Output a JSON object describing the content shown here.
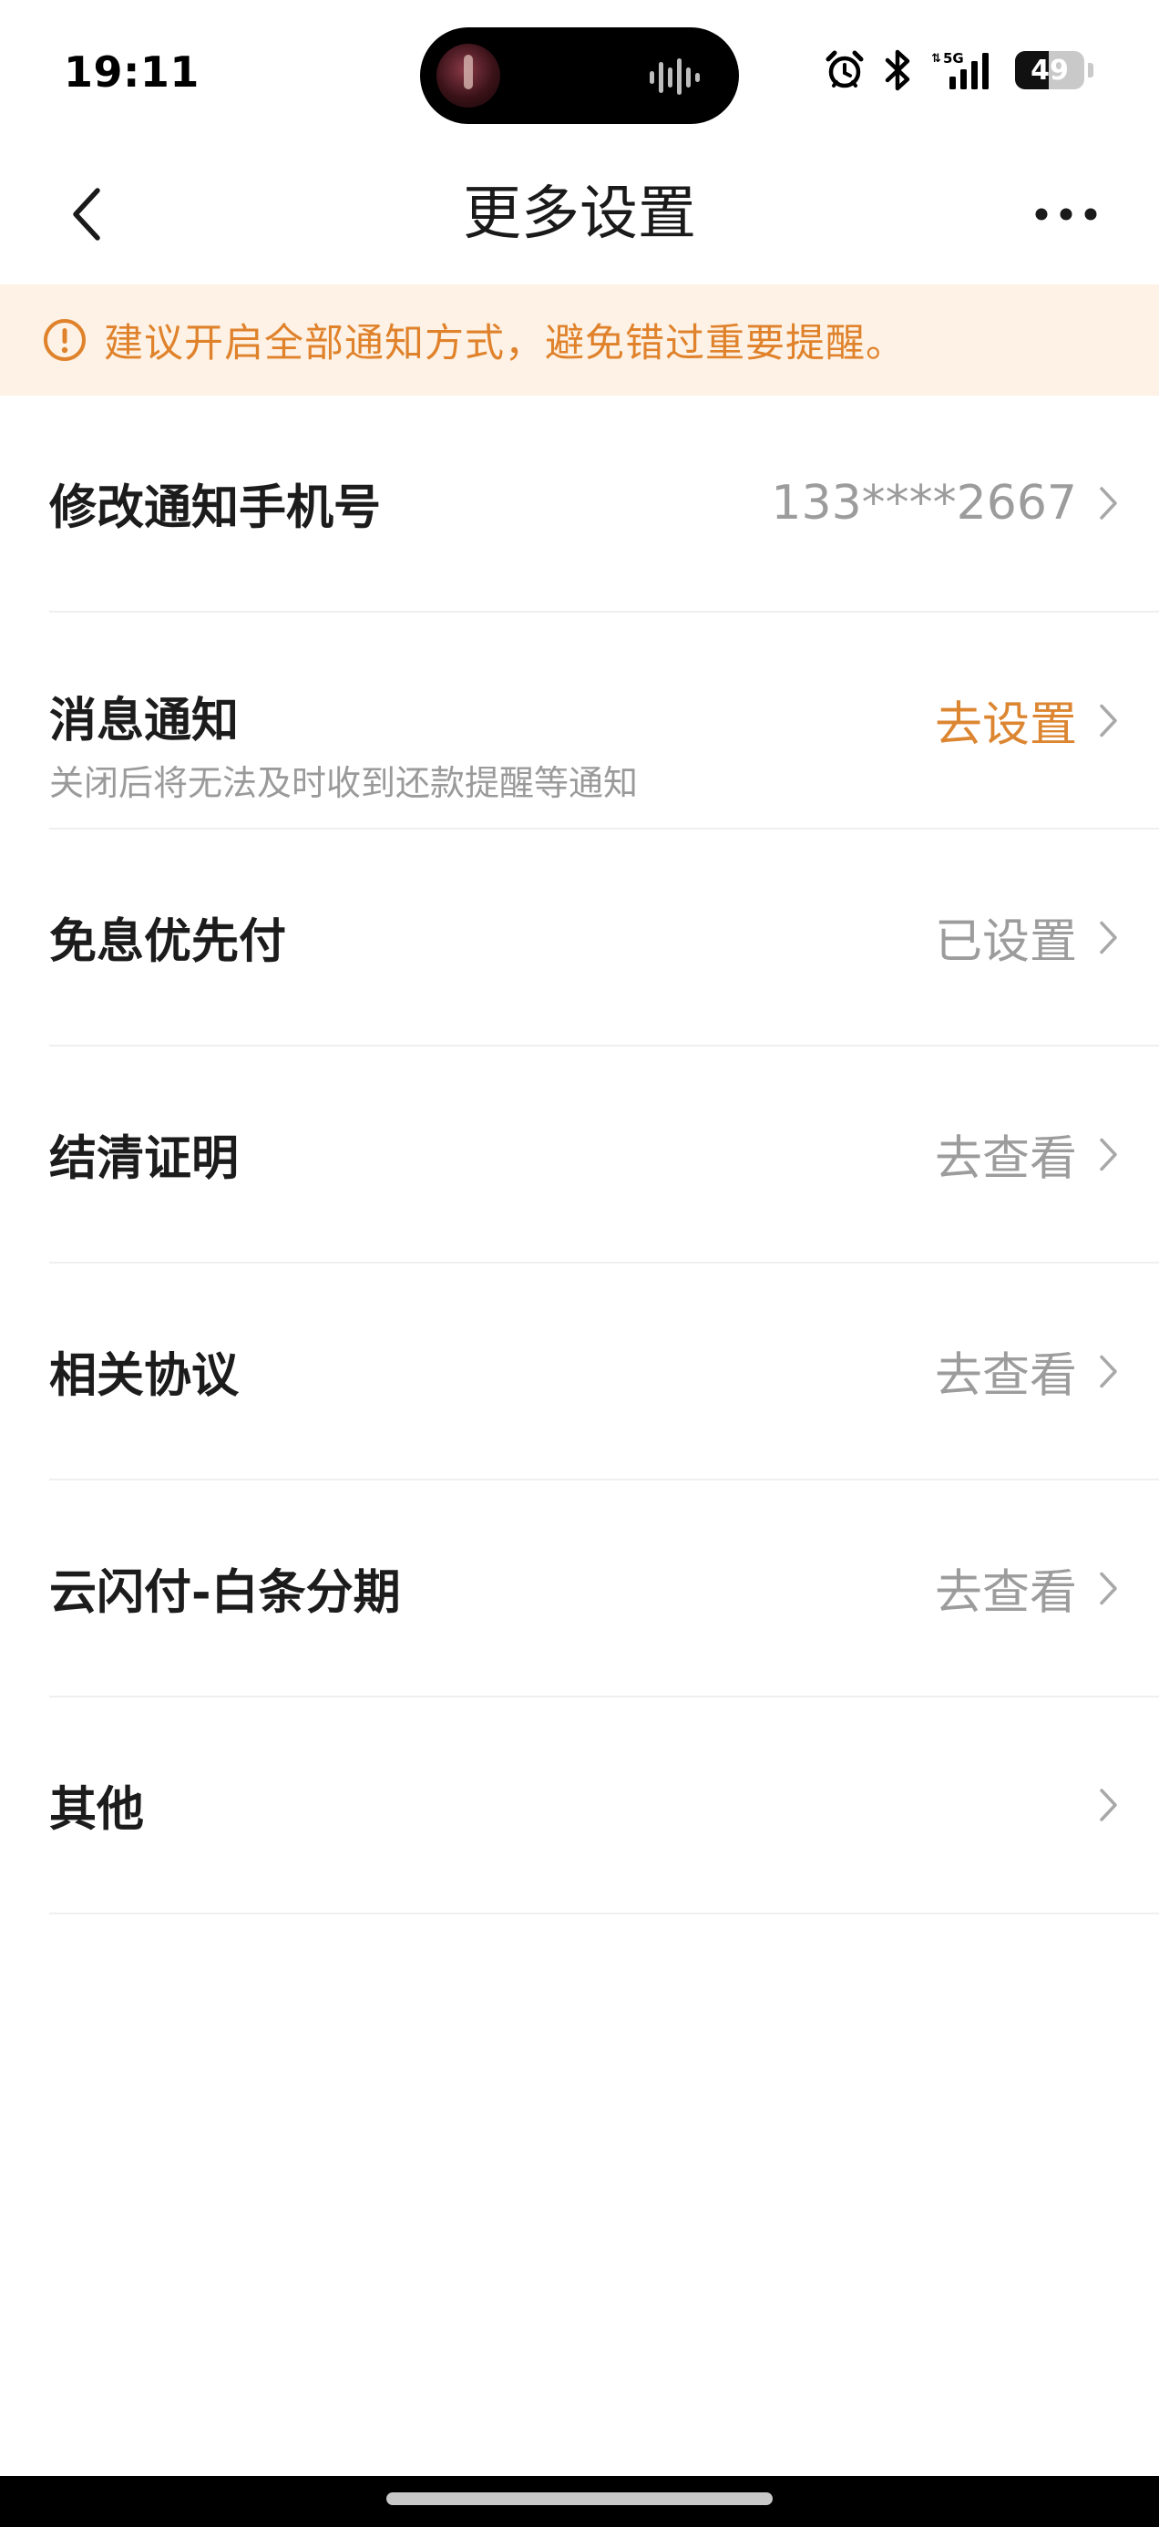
{
  "status_bar": {
    "time": "19:11",
    "network": "5G",
    "battery": "49",
    "battery_level_percent": 49
  },
  "nav": {
    "title": "更多设置",
    "back_icon": "chevron-left-icon",
    "more_icon": "more-dots-icon"
  },
  "notice": {
    "icon": "alert-circle-icon",
    "text": "建议开启全部通知方式，避免错过重要提醒。",
    "color": "#e0822b",
    "background": "#fdf2e5"
  },
  "rows": [
    {
      "title": "修改通知手机号",
      "value": "133****2667"
    },
    {
      "title": "消息通知",
      "subtitle": "关闭后将无法及时收到还款提醒等通知",
      "value": "去设置",
      "value_color": "#dc8632"
    },
    {
      "title": "免息优先付",
      "value": "已设置"
    },
    {
      "title": "结清证明",
      "value": "去查看"
    },
    {
      "title": "相关协议",
      "value": "去查看"
    },
    {
      "title": "云闪付-白条分期",
      "value": "去查看"
    },
    {
      "title": "其他",
      "value": ""
    }
  ]
}
